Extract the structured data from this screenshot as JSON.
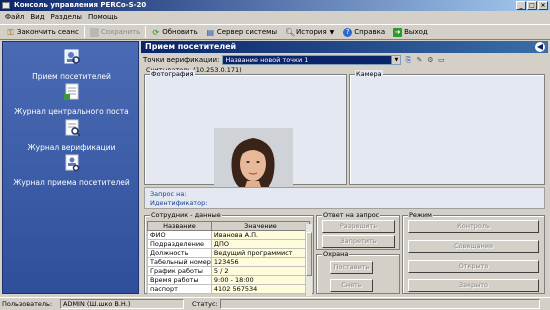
{
  "window": {
    "title": "Консоль управления PERCo-S-20"
  },
  "menu": [
    "Файл",
    "Вид",
    "Разделы",
    "Помощь"
  ],
  "toolbar": {
    "end_session": "Закончить сеанс",
    "save": "Сохранить",
    "refresh": "Обновить",
    "system_server": "Сервер системы",
    "history": "История",
    "help": "Справка",
    "exit": "Выход"
  },
  "sidebar": {
    "items": [
      {
        "label": "Прием посетителей",
        "icon": "visitor-reception-icon"
      },
      {
        "label": "Журнал центрального поста",
        "icon": "central-post-journal-icon"
      },
      {
        "label": "Журнал верификации",
        "icon": "verification-journal-icon"
      },
      {
        "label": "Журнал приема посетителей",
        "icon": "visitor-journal-icon"
      }
    ]
  },
  "main": {
    "title": "Прием посетителей",
    "vp_label": "Точки верификации:",
    "vp_selected": "Название новой точки 1",
    "reader": "Считыватель (10.253.0.171)",
    "photo_label": "Фотография",
    "camera_label": "Камера",
    "request_label": "Запрос на:",
    "identifier_label": "Идентификатор:"
  },
  "employee": {
    "group_title": "Сотрудник - данные",
    "col_name": "Название",
    "col_value": "Значение",
    "rows": [
      {
        "name": "ФИО",
        "value": "Иванова А.П."
      },
      {
        "name": "Подразделение",
        "value": "ДПО"
      },
      {
        "name": "Должность",
        "value": "Ведущий программист"
      },
      {
        "name": "Табельный номер",
        "value": "123456"
      },
      {
        "name": "График работы",
        "value": "5 / 2"
      },
      {
        "name": "Время работы",
        "value": "9:00 - 18:00"
      },
      {
        "name": "паспорт",
        "value": "4102 567534"
      }
    ]
  },
  "response": {
    "group_title": "Ответ на запрос",
    "allow": "Разрешить",
    "deny": "Запретить"
  },
  "security": {
    "group_title": "Охрана",
    "arm": "Поставить",
    "disarm": "Снять"
  },
  "mode": {
    "group_title": "Режим",
    "control": "Контроль",
    "combined": "Совещание",
    "open": "Открыто",
    "closed": "Закрыто"
  },
  "status": {
    "user_label": "Пользователь:",
    "user_value": "ADMIN (Ш.шко В.Н.)",
    "status_label": "Статус:",
    "status_value": ""
  },
  "colors": {
    "sidebar": "#3b5ca8",
    "header": "#0a246a",
    "value_cell": "#fffcdc"
  }
}
